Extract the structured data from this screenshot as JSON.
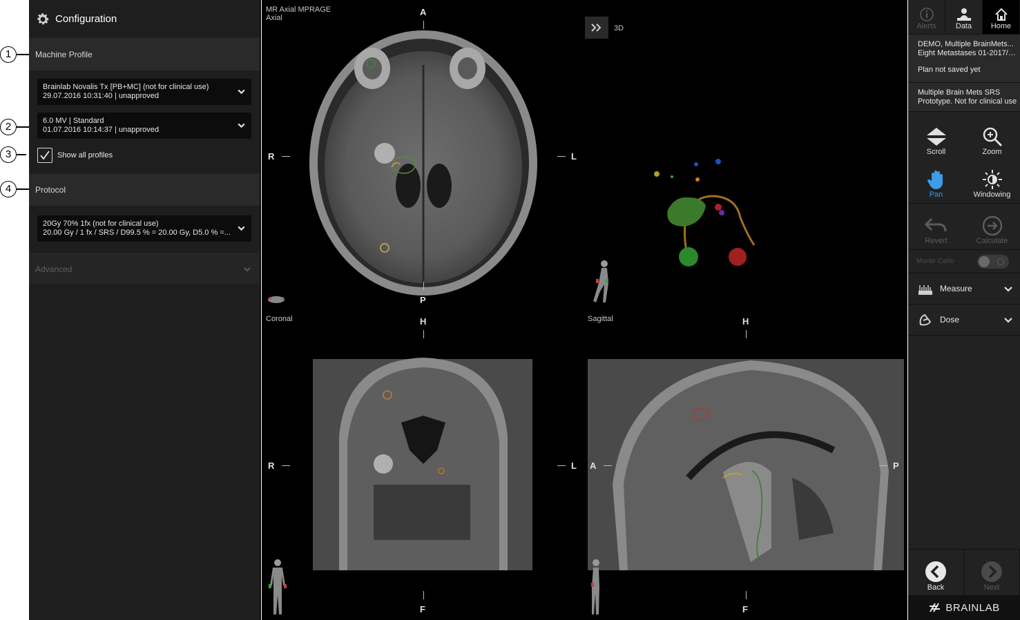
{
  "callouts": [
    "1",
    "2",
    "3",
    "4"
  ],
  "config": {
    "title": "Configuration",
    "machine_profile": {
      "title": "Machine Profile",
      "machine": {
        "line1": "Brainlab Novalis Tx [PB+MC] (not for clinical use)",
        "line2": "29.07.2016 10:31:40 | unapproved"
      },
      "energy": {
        "line1": "6.0 MV | Standard",
        "line2": "01.07.2016 10:14:37 | unapproved"
      },
      "show_all_label": "Show all profiles",
      "show_all_checked": true
    },
    "protocol": {
      "title": "Protocol",
      "value": {
        "line1": "20Gy 70% 1fx (not for clinical use)",
        "line2": "20.00 Gy / 1 fx / SRS / D99.5 % = 20.00 Gy, D5.0 % =..."
      }
    },
    "advanced_label": "Advanced"
  },
  "viewports": {
    "axial": {
      "label1": "MR Axial MPRAGE",
      "label2": "Axial",
      "top": "A",
      "bottom": "P",
      "left": "R",
      "right": "L"
    },
    "view3d": {
      "label": "3D"
    },
    "coronal": {
      "label": "Coronal",
      "top": "H",
      "bottom": "F",
      "left": "R",
      "right": "L"
    },
    "sagittal": {
      "label": "Sagittal",
      "top": "H",
      "bottom": "F",
      "left": "A",
      "right": "P"
    }
  },
  "right": {
    "tabs": {
      "alerts": "Alerts",
      "data": "Data",
      "home": "Home"
    },
    "patient": {
      "line1": "DEMO, Multiple BrainMets...",
      "line2": "Eight Metastases 01-2017/0...",
      "status": "Plan not saved yet"
    },
    "note": {
      "line1": "Multiple Brain Mets SRS",
      "line2": "Prototype. Not for clinical use"
    },
    "tools": {
      "scroll": "Scroll",
      "zoom": "Zoom",
      "pan": "Pan",
      "windowing": "Windowing"
    },
    "actions": {
      "revert": "Revert",
      "calculate": "Calculate",
      "monte_carlo": "Monte Carlo",
      "monte_carlo_on": false
    },
    "measure": "Measure",
    "dose": "Dose",
    "nav": {
      "back": "Back",
      "next": "Next"
    },
    "brand": "BRAINLAB"
  },
  "colors": {
    "accent": "#3c9ce8",
    "panel": "#1e1e1e",
    "section": "#2a2a2a"
  }
}
